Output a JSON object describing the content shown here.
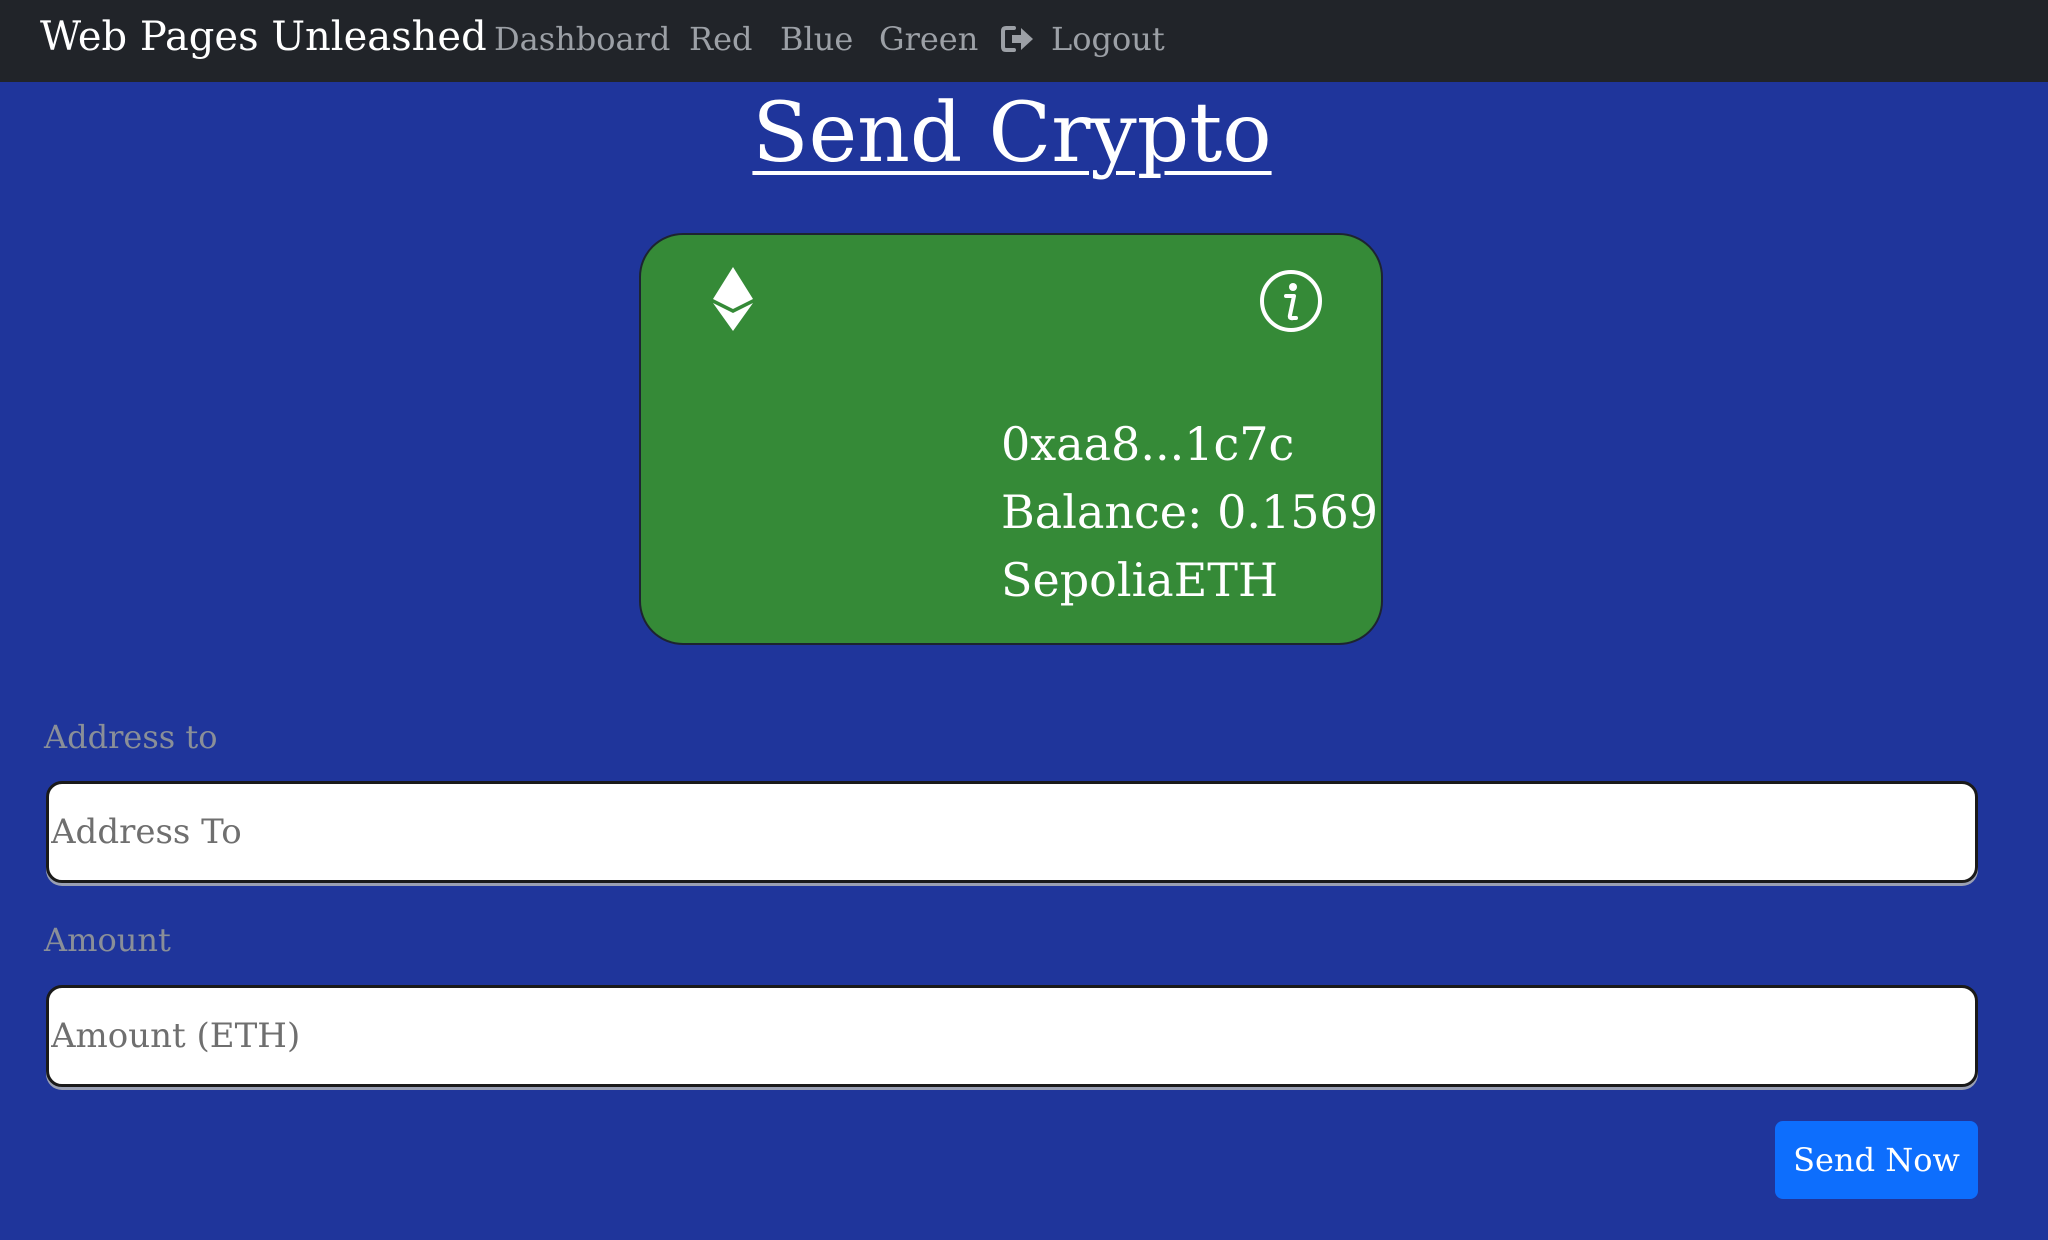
{
  "navbar": {
    "brand": "Web Pages Unleashed",
    "links": {
      "dashboard": "Dashboard",
      "red": "Red",
      "blue": "Blue",
      "green": "Green",
      "logout": "Logout"
    },
    "logout_icon": "sign-out-icon"
  },
  "page": {
    "title": "Send Crypto"
  },
  "wallet_card": {
    "address": "0xaa8...1c7c",
    "balance": "Balance: 0.1569",
    "currency": "SepoliaETH",
    "left_icon": "ethereum-icon",
    "right_icon": "info-icon",
    "background_color": "#358a37"
  },
  "form": {
    "address_label": "Address to",
    "address_placeholder": "Address To",
    "amount_label": "Amount",
    "amount_placeholder": "Amount (ETH)",
    "submit_label": "Send Now"
  },
  "colors": {
    "page_background": "#1f359b",
    "navbar_background": "#212429",
    "button_primary": "#0d6efd"
  }
}
